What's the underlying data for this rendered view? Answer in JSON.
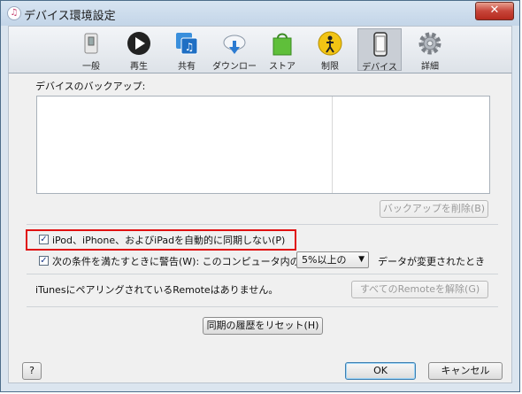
{
  "window": {
    "title": "デバイス環境設定",
    "close_glyph": "✕"
  },
  "toolbar": {
    "items": [
      {
        "label": "一般",
        "icon": "general-switch-icon",
        "selected": false
      },
      {
        "label": "再生",
        "icon": "play-icon",
        "selected": false
      },
      {
        "label": "共有",
        "icon": "sharing-icon",
        "selected": false
      },
      {
        "label": "ダウンロード",
        "icon": "cloud-download-icon",
        "selected": false
      },
      {
        "label": "ストア",
        "icon": "store-bag-icon",
        "selected": false
      },
      {
        "label": "制限",
        "icon": "parental-restrictions-icon",
        "selected": false
      },
      {
        "label": "デバイス",
        "icon": "device-phone-icon",
        "selected": true
      },
      {
        "label": "詳細",
        "icon": "gear-icon",
        "selected": false
      }
    ]
  },
  "content": {
    "backup_label": "デバイスのバックアップ:",
    "delete_backup_button": "バックアップを削除(B)",
    "prevent_sync_checkbox": {
      "label": "iPod、iPhone、およびiPadを自動的に同期しない(P)",
      "checked": true
    },
    "warn_checkbox": {
      "label": "次の条件を満たすときに警告(W): このコンピュータ内の",
      "checked": true
    },
    "warn_select": {
      "value": "5%以上の"
    },
    "warn_suffix": "データが変更されたとき",
    "remote_text": "iTunesにペアリングされているRemoteはありません。",
    "remote_reset_button": "すべてのRemoteを解除(G)",
    "reset_history_button": "同期の履歴をリセット(H)"
  },
  "footer": {
    "help_button": "?",
    "ok_button": "OK",
    "cancel_button": "キャンセル"
  },
  "colors": {
    "highlight": "#e01010",
    "titlebar": "#c3d5e8",
    "close_button": "#c7453a"
  }
}
